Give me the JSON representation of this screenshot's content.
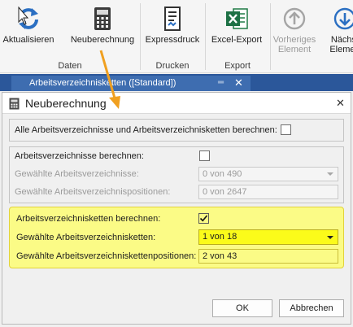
{
  "ribbon": {
    "buttons": [
      {
        "label": "Aktualisieren",
        "icon": "refresh-icon"
      },
      {
        "label": "Neuberechnung",
        "icon": "calculator-icon"
      },
      {
        "label": "Expressdruck",
        "icon": "print-document-icon"
      },
      {
        "label": "Excel-Export",
        "icon": "excel-icon"
      },
      {
        "label1": "Vorheriges",
        "label2": "Element",
        "icon": "arrow-up-circle-icon",
        "disabled": true
      },
      {
        "label1": "Nächst",
        "label2": "Elemen",
        "icon": "arrow-down-circle-icon"
      }
    ],
    "groups": [
      "Daten",
      "Drucken",
      "Export"
    ]
  },
  "tab": {
    "label": "Arbeitsverzeichnisketten ([Standard])"
  },
  "dialog": {
    "title": "Neuberechnung",
    "all_label": "Alle Arbeitsverzeichnisse und Arbeitsverzeichnisketten berechnen:",
    "all_checked": false,
    "av": {
      "label": "Arbeitsverzeichnisse berechnen:",
      "checked": false,
      "selected_label": "Gewählte Arbeitsverzeichnisse:",
      "selected_value": "0 von 490",
      "positions_label": "Gewählte Arbeitsverzeichnispositionen:",
      "positions_value": "0 von 2647"
    },
    "avk": {
      "label": "Arbeitsverzeichnisketten berechnen:",
      "checked": true,
      "selected_label": "Gewählte Arbeitsverzeichnisketten:",
      "selected_value": "1 von 18",
      "positions_label": "Gewählte Arbeitsverzeichniskettenpositionen:",
      "positions_value": "2 von 43"
    },
    "ok": "OK",
    "cancel": "Abbrechen"
  },
  "colors": {
    "accent": "#2b579a",
    "highlight": "#fbfb86",
    "arrow": "#f0a020"
  }
}
